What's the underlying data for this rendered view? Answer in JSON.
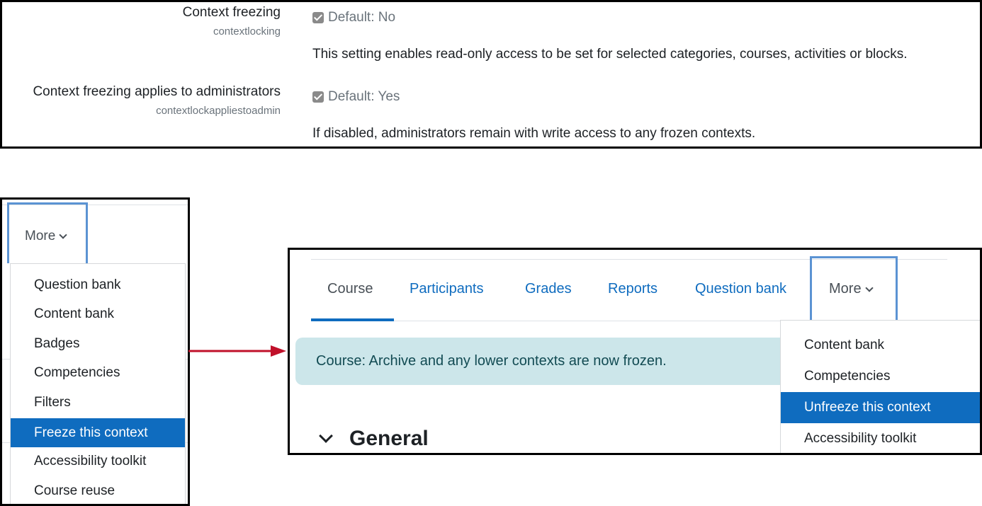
{
  "settings": [
    {
      "label": "Context freezing",
      "key": "contextlocking",
      "checked": true,
      "default": "Default: No",
      "description": "This setting enables read-only access to be set for selected categories, courses, activities or blocks."
    },
    {
      "label": "Context freezing applies to administrators",
      "key": "contextlockappliestoadmin",
      "checked": true,
      "default": "Default: Yes",
      "description": "If disabled, administrators remain with write access to any frozen contexts."
    }
  ],
  "left_panel": {
    "more_label": "More",
    "menu_items": [
      {
        "label": "Question bank",
        "active": false
      },
      {
        "label": "Content bank",
        "active": false
      },
      {
        "label": "Badges",
        "active": false
      },
      {
        "label": "Competencies",
        "active": false
      },
      {
        "label": "Filters",
        "active": false
      },
      {
        "label": "Freeze this context",
        "active": true
      },
      {
        "label": "Accessibility toolkit",
        "active": false
      },
      {
        "label": "Course reuse",
        "active": false
      }
    ]
  },
  "right_panel": {
    "tabs": [
      {
        "label": "Course",
        "current": true
      },
      {
        "label": "Participants",
        "current": false
      },
      {
        "label": "Grades",
        "current": false
      },
      {
        "label": "Reports",
        "current": false
      },
      {
        "label": "Question bank",
        "current": false
      }
    ],
    "more_label": "More",
    "alert_message": "Course: Archive and any lower contexts are now frozen.",
    "section_title": "General",
    "menu_items": [
      {
        "label": "Content bank",
        "active": false
      },
      {
        "label": "Competencies",
        "active": false
      },
      {
        "label": "Unfreeze this context",
        "active": true
      },
      {
        "label": "Accessibility toolkit",
        "active": false
      }
    ]
  },
  "colors": {
    "accent": "#0f6cbf",
    "highlight_border": "#5b93d3",
    "alert_bg": "#cce6ea",
    "alert_text": "#124b53",
    "arrow": "#c0102a"
  }
}
